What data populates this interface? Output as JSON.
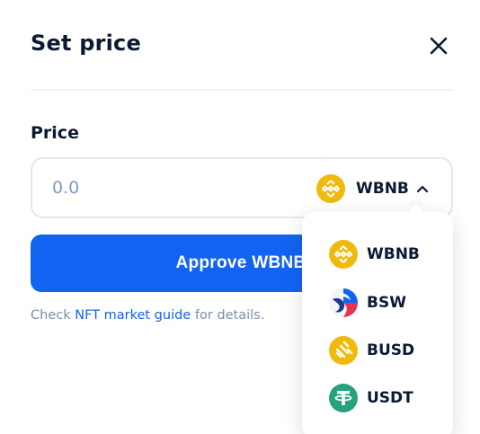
{
  "modal": {
    "title": "Set price",
    "price_label": "Price",
    "price_input": {
      "placeholder": "0.0",
      "value": ""
    },
    "currency": {
      "selected": "WBNB",
      "icon": "bnb-coin-icon"
    },
    "approve_button": "Approve WBNB",
    "hint": {
      "prefix": "Check ",
      "link": "NFT market guide",
      "suffix": " for details."
    },
    "currency_options": [
      {
        "label": "WBNB",
        "icon": "bnb-coin-icon"
      },
      {
        "label": "BSW",
        "icon": "bsw-coin-icon"
      },
      {
        "label": "BUSD",
        "icon": "busd-coin-icon"
      },
      {
        "label": "USDT",
        "icon": "usdt-coin-icon"
      }
    ]
  },
  "colors": {
    "primary": "#1263f1",
    "bnb": "#f0b90b",
    "usdt": "#26a17b",
    "text": "#0b1a33",
    "muted": "#7f8ea6",
    "placeholder": "#7f9bc6"
  }
}
